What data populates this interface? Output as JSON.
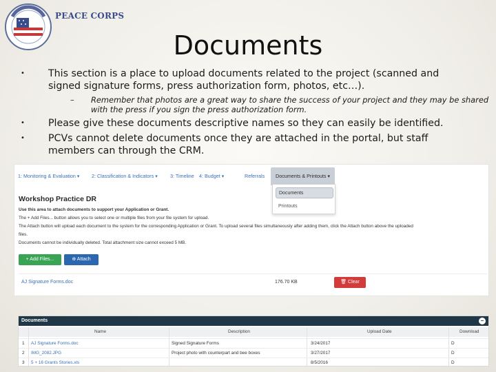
{
  "logo": {
    "text": "PEACE CORPS",
    "seal_text": "PEACE CORPS"
  },
  "title": "Documents",
  "bullets": [
    "This section is a place to upload documents related to the project (scanned and signed signature forms, press authorization form, photos, etc…).",
    "Please give these documents descriptive names so they can easily be identified.",
    "PCVs cannot delete documents once they are attached in the portal, but staff members can through the CRM."
  ],
  "sub_bullet": "Remember that photos are a great way to share the success of your project and they may be shared with the press if you sign the press authorization form.",
  "portal": {
    "tabs": [
      "1: Monitoring & Evaluation ▾",
      "2: Classification & Indicators ▾",
      "3: Timeline",
      "4: Budget ▾",
      "Referrals",
      "Documents & Printouts ▾"
    ],
    "dropdown": [
      "Documents",
      "Printouts"
    ],
    "section_title": "Workshop Practice DR",
    "instructions": [
      "Use this area to attach documents to support your Application or Grant.",
      "The + Add Files... button allows you to select one or multiple files from your file system for upload.",
      "The Attach button will upload each document to the system for the corresponding Application or Grant. To upload several files simultaneously after adding them, click the Attach button above the uploaded",
      "files.",
      "Documents cannot be individually deleted. Total attachment size cannot exceed 5 MB."
    ],
    "add_button": "+ Add Files...",
    "attach_button": "⊕ Attach",
    "pending_file": {
      "name": "AJ Signature Forms.doc",
      "size": "176.70 KB"
    },
    "clear_button": "🗑 Clear",
    "documents": {
      "header": "Documents",
      "toggle": "−",
      "columns": [
        "Name",
        "Description",
        "Upload Date",
        "Download"
      ],
      "rows": [
        {
          "num": "1",
          "name": "AJ Signature Forms.doc",
          "description": "Signed Signature Forms",
          "date": "3/24/2017",
          "download": "D"
        },
        {
          "num": "2",
          "name": "IMG_2082.JPG",
          "description": "Project photo with counterpart and bee boxes",
          "date": "3/27/2017",
          "download": "D"
        },
        {
          "num": "3",
          "name": "5 + 16 Grants Stories.xls",
          "description": "",
          "date": "8/5/2016",
          "download": "D"
        }
      ]
    }
  },
  "colors": {
    "tab_link": "#3b6fb6",
    "add": "#3aa455",
    "attach": "#2b68b0",
    "clear": "#d33a3a",
    "doc_header": "#1f3747"
  }
}
